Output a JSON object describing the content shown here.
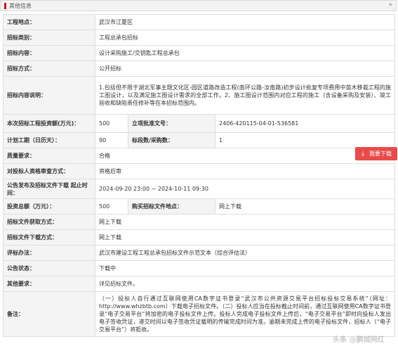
{
  "section": {
    "title": "其他信息"
  },
  "fields": {
    "location": {
      "label": "工程地点：",
      "value": "武汉市江夏区"
    },
    "category": {
      "label": "招标类别：",
      "value": "工程总承包招标"
    },
    "content": {
      "label": "招标内容：",
      "value": "设计采购施工/交钥匙工程总承包"
    },
    "method": {
      "label": "招标方式：",
      "value": "公开招标"
    },
    "description": {
      "label": "招标内容说明：",
      "value": "1.包括但不限于湖北军事主题文化区-园区道路改造工程(南环公路-汝南路)初步设计批复专项费用中苗木移栽工程的施工图设计，以及满足施工图设计需求的全部工作。2、施工图设计范围内对应工程的施工（含设备采购及安装）、竣工验收和缺陷责任修补等在本招标范围内。"
    },
    "investment": {
      "label": "本次招标工程投资额(万元)：",
      "value": "500"
    },
    "approval_no": {
      "label": "立项批准文号：",
      "value": "2406-420115-04-01-536581"
    },
    "duration": {
      "label": "计划工期（日历天）：",
      "value": "90"
    },
    "sections_count": {
      "label": "标段数/采购数：",
      "value": "1"
    },
    "quality": {
      "label": "质量要求：",
      "value": "合格"
    },
    "qualification": {
      "label": "对投标人资格审查方式：",
      "value": "资格后审"
    },
    "announce_time": {
      "label": "公告发布及招标文件下载 起止时间：",
      "value": "2024-09-20 23:00 ~ 2024-10-11 09:30"
    },
    "total_invest": {
      "label": "投资总额（万元）：",
      "value": "500"
    },
    "purchase_loc": {
      "label": "购买招标文件地点：",
      "value": "网上下载"
    },
    "obtain_method": {
      "label": "招标文件获取方式：",
      "value": "网上下载"
    },
    "download_method": {
      "label": "招标文件下载方式：",
      "value": "网上下载"
    },
    "evaluation": {
      "label": "评标办法：",
      "value": "武汉市建设工程工程总承包招标文件示范文本（综合评估法）"
    },
    "status": {
      "label": "公告状态：",
      "value": "下载中"
    },
    "other": {
      "label": "其他要求：",
      "value": "详见招标文件。"
    },
    "remarks": {
      "label": "备注：",
      "value": "（一）投标人自行通过互联网使用CA数字证书登录“武汉市公共资源交易平台招标投标交易系统”（网址：http://www.whzbtb.com）下载电子招标文件。（二）投标人应当在投标截止时间前，通过互联网使用CA数字证书登录“电子交易平台”将加密的电子投标文件上传。投标人完成电子投标文件上传后，“电子交易平台”即时向投标人发出电子签收凭证，递交时间以电子签收凭证载明的传输完成时间为准。逾期未完成上传的电子投标文件，招标人（“电子交易平台”）将拒收。"
    }
  },
  "download_button": {
    "label": "我要下载",
    "icon": "download-icon"
  },
  "watermark": "头条 @鹏城网红",
  "colors": {
    "accent": "#c8161d",
    "button": "#e94a4a",
    "status": "#1a8f1a",
    "label_bg": "#f4f4f4"
  }
}
